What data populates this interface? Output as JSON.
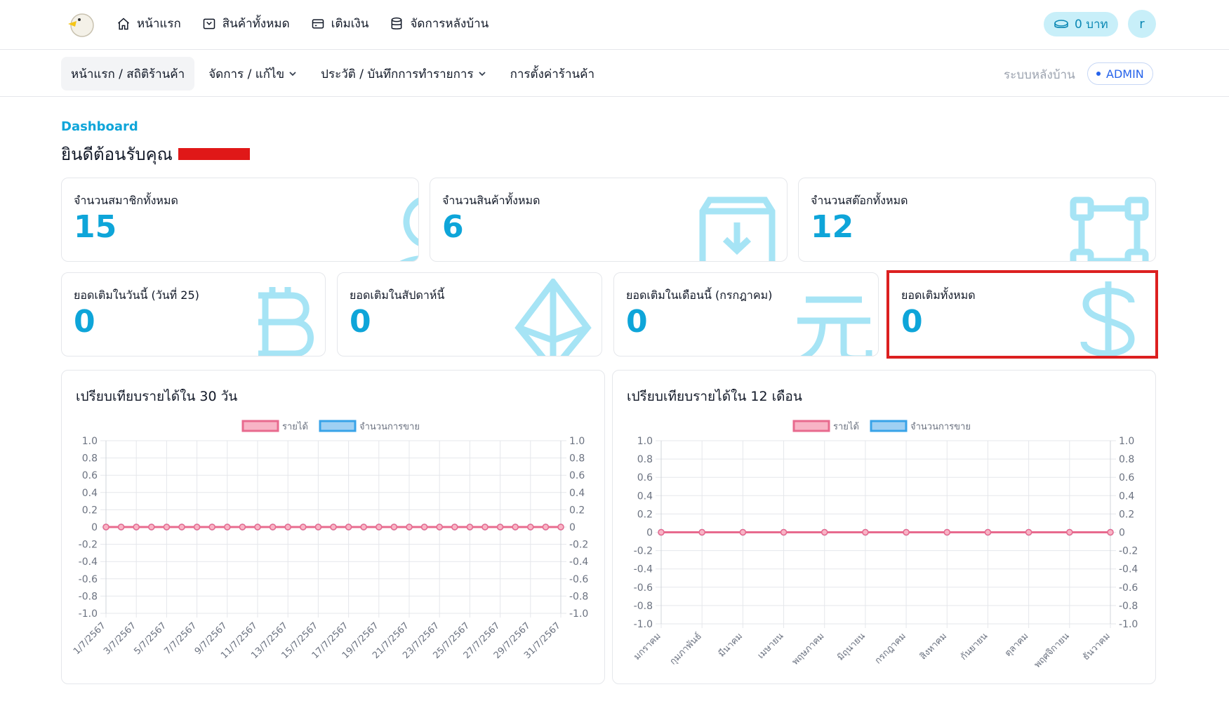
{
  "topnav": {
    "items": [
      {
        "label": "หน้าแรก",
        "icon": "home-icon"
      },
      {
        "label": "สินค้าทั้งหมด",
        "icon": "box-icon"
      },
      {
        "label": "เติมเงิน",
        "icon": "wallet-icon"
      },
      {
        "label": "จัดการหลังบ้าน",
        "icon": "database-icon"
      }
    ],
    "balance": "0 บาท",
    "avatar": "r"
  },
  "subnav": {
    "tabs": [
      {
        "label": "หน้าแรก / สถิติร้านค้า",
        "active": true
      },
      {
        "label": "จัดการ / แก้ไข",
        "dropdown": true
      },
      {
        "label": "ประวัติ / บันทึกการทำรายการ",
        "dropdown": true
      },
      {
        "label": "การตั้งค่าร้านค้า"
      }
    ],
    "backend_label": "ระบบหลังบ้าน",
    "role_badge": "ADMIN"
  },
  "header": {
    "breadcrumb": "Dashboard",
    "welcome": "ยินดีต้อนรับคุณ"
  },
  "stats_top": [
    {
      "label": "จำนวนสมาชิกทั้งหมด",
      "value": "15",
      "icon": "user-icon"
    },
    {
      "label": "จำนวนสินค้าทั้งหมด",
      "value": "6",
      "icon": "archive-download-icon"
    },
    {
      "label": "จำนวนสต๊อกทั้งหมด",
      "value": "12",
      "icon": "vector-square-icon"
    }
  ],
  "stats_bottom": [
    {
      "label": "ยอดเติมในวันนี้ (วันที่ 25)",
      "value": "0",
      "icon": "bitcoin-icon"
    },
    {
      "label": "ยอดเติมในสัปดาห์นี้",
      "value": "0",
      "icon": "ethereum-icon"
    },
    {
      "label": "ยอดเติมในเดือนนี้ (กรกฎาคม)",
      "value": "0",
      "icon": "yuan-icon"
    },
    {
      "label": "ยอดเติมทั้งหมด",
      "value": "0",
      "icon": "dollar-icon"
    }
  ],
  "colors": {
    "accent": "#0ea5d9",
    "income": "#e86a8e",
    "sales": "#38a3e8",
    "highlight": "#dc2020"
  },
  "chart_data": [
    {
      "type": "line",
      "title": "เปรียบเทียบรายได้ใน 30 วัน",
      "series": [
        {
          "name": "รายได้",
          "values": [
            0,
            0,
            0,
            0,
            0,
            0,
            0,
            0,
            0,
            0,
            0,
            0,
            0,
            0,
            0,
            0,
            0,
            0,
            0,
            0,
            0,
            0,
            0,
            0,
            0,
            0,
            0,
            0,
            0,
            0,
            0
          ]
        },
        {
          "name": "จำนวนการขาย",
          "values": [
            0,
            0,
            0,
            0,
            0,
            0,
            0,
            0,
            0,
            0,
            0,
            0,
            0,
            0,
            0,
            0,
            0,
            0,
            0,
            0,
            0,
            0,
            0,
            0,
            0,
            0,
            0,
            0,
            0,
            0,
            0
          ]
        }
      ],
      "x": [
        "1/7/2567",
        "2/7/2567",
        "3/7/2567",
        "4/7/2567",
        "5/7/2567",
        "6/7/2567",
        "7/7/2567",
        "8/7/2567",
        "9/7/2567",
        "10/7/2567",
        "11/7/2567",
        "12/7/2567",
        "13/7/2567",
        "14/7/2567",
        "15/7/2567",
        "16/7/2567",
        "17/7/2567",
        "18/7/2567",
        "19/7/2567",
        "20/7/2567",
        "21/7/2567",
        "22/7/2567",
        "23/7/2567",
        "24/7/2567",
        "25/7/2567",
        "26/7/2567",
        "27/7/2567",
        "28/7/2567",
        "29/7/2567",
        "30/7/2567",
        "31/7/2567"
      ],
      "x_tick_labels": [
        "1/7/2567",
        "3/7/2567",
        "5/7/2567",
        "7/7/2567",
        "9/7/2567",
        "11/7/2567",
        "13/7/2567",
        "15/7/2567",
        "17/7/2567",
        "19/7/2567",
        "21/7/2567",
        "23/7/2567",
        "25/7/2567",
        "27/7/2567",
        "29/7/2567",
        "31/7/2567"
      ],
      "y_ticks": [
        "1.0",
        "0.8",
        "0.6",
        "0.4",
        "0.2",
        "0",
        "-0.2",
        "-0.4",
        "-0.6",
        "-0.8",
        "-1.0"
      ],
      "ylim": [
        -1,
        1
      ],
      "legend": "top",
      "grid": true
    },
    {
      "type": "line",
      "title": "เปรียบเทียบรายได้ใน 12 เดือน",
      "series": [
        {
          "name": "รายได้",
          "values": [
            0,
            0,
            0,
            0,
            0,
            0,
            0,
            0,
            0,
            0,
            0,
            0
          ]
        },
        {
          "name": "จำนวนการขาย",
          "values": [
            0,
            0,
            0,
            0,
            0,
            0,
            0,
            0,
            0,
            0,
            0,
            0
          ]
        }
      ],
      "x": [
        "มกราคม",
        "กุมภาพันธ์",
        "มีนาคม",
        "เมษายน",
        "พฤษภาคม",
        "มิถุนายน",
        "กรกฎาคม",
        "สิงหาคม",
        "กันยายน",
        "ตุลาคม",
        "พฤศจิกายน",
        "ธันวาคม"
      ],
      "x_tick_labels": [
        "มกราคม",
        "กุมภาพันธ์",
        "มีนาคม",
        "เมษายน",
        "พฤษภาคม",
        "มิถุนายน",
        "กรกฎาคม",
        "สิงหาคม",
        "กันยายน",
        "ตุลาคม",
        "พฤศจิกายน",
        "ธันวาคม"
      ],
      "y_ticks": [
        "1.0",
        "0.8",
        "0.6",
        "0.4",
        "0.2",
        "0",
        "-0.2",
        "-0.4",
        "-0.6",
        "-0.8",
        "-1.0"
      ],
      "ylim": [
        -1,
        1
      ],
      "legend": "top",
      "grid": true
    }
  ]
}
